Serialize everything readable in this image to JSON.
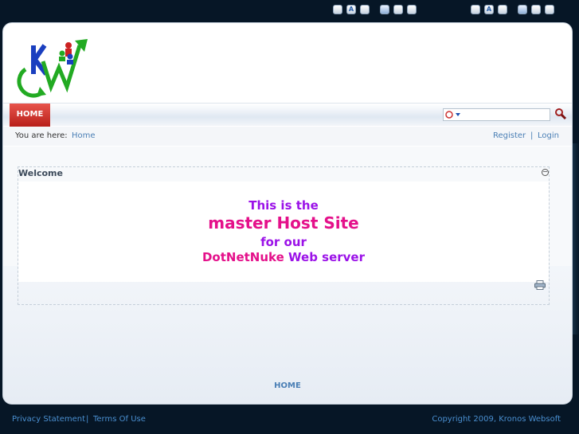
{
  "nav": {
    "home_tab": "HOME"
  },
  "breadcrumb": {
    "label": "You are here:",
    "home": "Home"
  },
  "account": {
    "register": "Register",
    "separator": "|",
    "login": "Login"
  },
  "module": {
    "title": "Welcome",
    "line1": "This is the",
    "line2": "master Host Site",
    "line3": "for our",
    "line4a": "DotNetNuke",
    "line4b": "Web server"
  },
  "footer": {
    "nav_home": "HOME",
    "privacy": "Privacy Statement",
    "separator": "|",
    "terms": "Terms Of Use",
    "copyright": "Copyright 2009, Kronos Websoft"
  },
  "top_toolbar": {
    "a_label": "A"
  },
  "colors": {
    "accent_red": "#c8281f",
    "link_blue": "#4a7fb5",
    "purple": "#9b12e8",
    "magenta": "#e4108a"
  },
  "icons": [
    "font-size-icon",
    "layout-icon",
    "search-icon",
    "minimize-icon",
    "print-icon",
    "logo-icon"
  ]
}
